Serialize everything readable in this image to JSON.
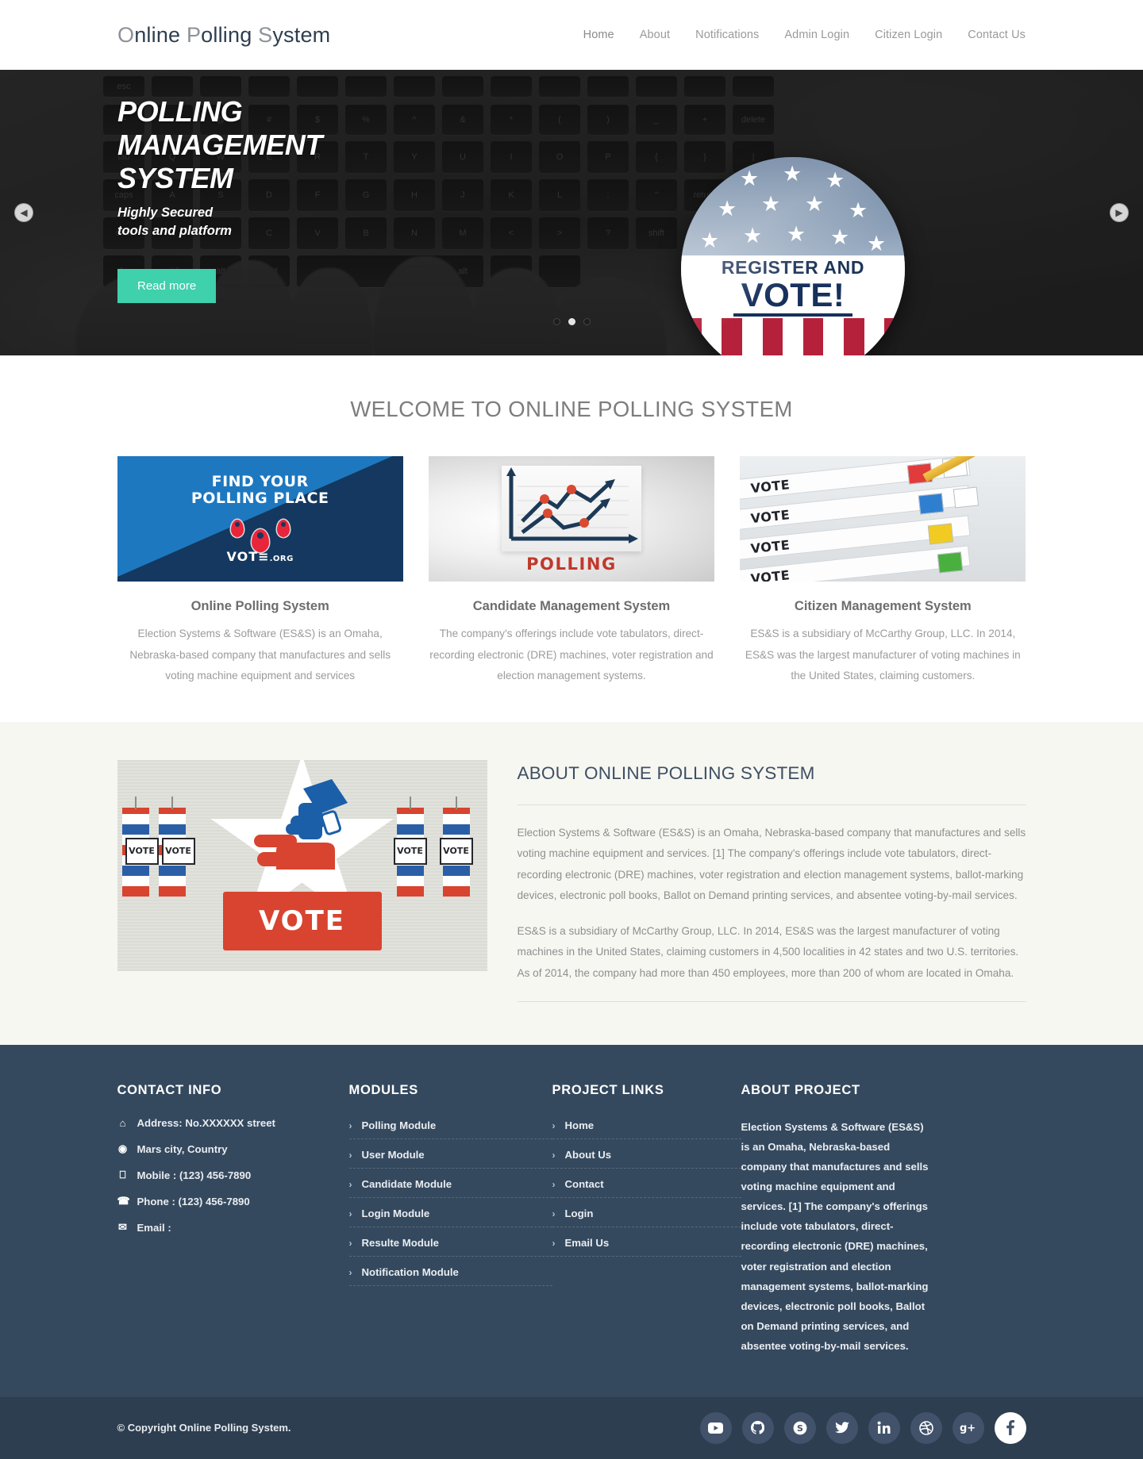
{
  "header": {
    "logo": {
      "part1_light": "O",
      "part1_dark": "nline ",
      "part2_light": "P",
      "part2_dark": "olling ",
      "part3_light": "S",
      "part3_dark": "ystem"
    },
    "nav": [
      {
        "label": "Home"
      },
      {
        "label": "About"
      },
      {
        "label": "Notifications"
      },
      {
        "label": "Admin Login"
      },
      {
        "label": "Citizen Login"
      },
      {
        "label": "Contact Us"
      }
    ]
  },
  "hero": {
    "title_line1": "POLLING",
    "title_line2": "MANAGEMENT",
    "title_line3": "SYSTEM",
    "subtitle_line1": "Highly Secured",
    "subtitle_line2": "tools and platform",
    "button_label": "Read more",
    "button_color": "#3fd0ac",
    "prev_icon": "◀",
    "next_icon": "▶",
    "badge": {
      "line1": "REGISTER AND",
      "line2": "VOTE!"
    },
    "dots": [
      {
        "active": false
      },
      {
        "active": true
      },
      {
        "active": false
      }
    ]
  },
  "welcome": {
    "heading": "WELCOME TO ONLINE POLLING SYSTEM",
    "cards": [
      {
        "title": "Online Polling System",
        "text": "Election Systems & Software (ES&S) is an Omaha, Nebraska-based company that manufactures and sells voting machine equipment and services",
        "art": {
          "headline_line1": "FIND YOUR",
          "headline_line2": "POLLING PLACE",
          "brand": "VOT≡",
          "brand_suffix": ".ORG"
        }
      },
      {
        "title": "Candidate Management System",
        "text": "The company's offerings include vote tabulators, direct-recording electronic (DRE) machines, voter registration and election management systems.",
        "art": {
          "caption": "POLLING"
        }
      },
      {
        "title": "Citizen Management System",
        "text": "ES&S is a subsidiary of McCarthy Group, LLC. In 2014, ES&S was the largest manufacturer of voting machines in the United States, claiming customers.",
        "art": {
          "rows": [
            "VOTE",
            "VOTE",
            "VOTE",
            "VOTE"
          ]
        }
      }
    ]
  },
  "about": {
    "heading": "ABOUT ONLINE POLLING SYSTEM",
    "paragraph1": "Election Systems & Software (ES&S) is an Omaha, Nebraska-based company that manufactures and sells voting machine equipment and services. [1] The company's offerings include vote tabulators, direct-recording electronic (DRE) machines, voter registration and election management systems, ballot-marking devices, electronic poll books, Ballot on Demand printing services, and absentee voting-by-mail services.",
    "paragraph2": "ES&S is a subsidiary of McCarthy Group, LLC. In 2014, ES&S was the largest manufacturer of voting machines in the United States, claiming customers in 4,500 localities in 42 states and two U.S. territories. As of 2014, the company had more than 450 employees, more than 200 of whom are located in Omaha.",
    "art": {
      "vote_cards": [
        "VOTE",
        "VOTE",
        "VOTE",
        "VOTE"
      ],
      "big_label": "VOTE"
    }
  },
  "footer": {
    "contact": {
      "heading": "CONTACT INFO",
      "items": [
        {
          "icon": "home-icon",
          "glyph": "⌂",
          "label": "Address: No.XXXXXX street"
        },
        {
          "icon": "globe-icon",
          "glyph": "◉",
          "label": "Mars city, Country"
        },
        {
          "icon": "mobile-icon",
          "glyph": "⎕",
          "label": "Mobile : (123) 456-7890"
        },
        {
          "icon": "phone-icon",
          "glyph": "☎",
          "label": "Phone : (123) 456-7890"
        },
        {
          "icon": "envelope-icon",
          "glyph": "✉",
          "label": "Email :"
        }
      ]
    },
    "modules": {
      "heading": "MODULES",
      "items": [
        {
          "label": "Polling Module"
        },
        {
          "label": "User Module"
        },
        {
          "label": "Candidate Module"
        },
        {
          "label": "Login Module"
        },
        {
          "label": "Resulte Module"
        },
        {
          "label": "Notification Module"
        }
      ]
    },
    "project_links": {
      "heading": "PROJECT LINKS",
      "items": [
        {
          "label": "Home"
        },
        {
          "label": "About Us"
        },
        {
          "label": "Contact"
        },
        {
          "label": "Login"
        },
        {
          "label": "Email Us"
        }
      ]
    },
    "about_project": {
      "heading": "ABOUT PROJECT",
      "text": "Election Systems & Software (ES&S) is an Omaha, Nebraska-based company that manufactures and sells voting machine equipment and services. [1] The company's offerings include vote tabulators, direct-recording electronic (DRE) machines, voter registration and election management systems, ballot-marking devices, electronic poll books, Ballot on Demand printing services, and absentee voting-by-mail services."
    },
    "copyright": "© Copyright Online Polling System.",
    "socials": [
      {
        "name": "youtube-icon",
        "glyph": "▶"
      },
      {
        "name": "github-icon",
        "glyph": "●"
      },
      {
        "name": "skype-icon",
        "glyph": "S"
      },
      {
        "name": "twitter-icon",
        "glyph": "ᴛ"
      },
      {
        "name": "linkedin-icon",
        "glyph": "in"
      },
      {
        "name": "dribbble-icon",
        "glyph": "◎"
      },
      {
        "name": "googleplus-icon",
        "glyph": "g+"
      },
      {
        "name": "facebook-icon",
        "glyph": "f"
      }
    ]
  },
  "colors": {
    "footer_bg": "#35495e",
    "bottom_bar_bg": "#2d3e50",
    "accent": "#3fd0ac",
    "about_bg": "#f7f7f2"
  }
}
